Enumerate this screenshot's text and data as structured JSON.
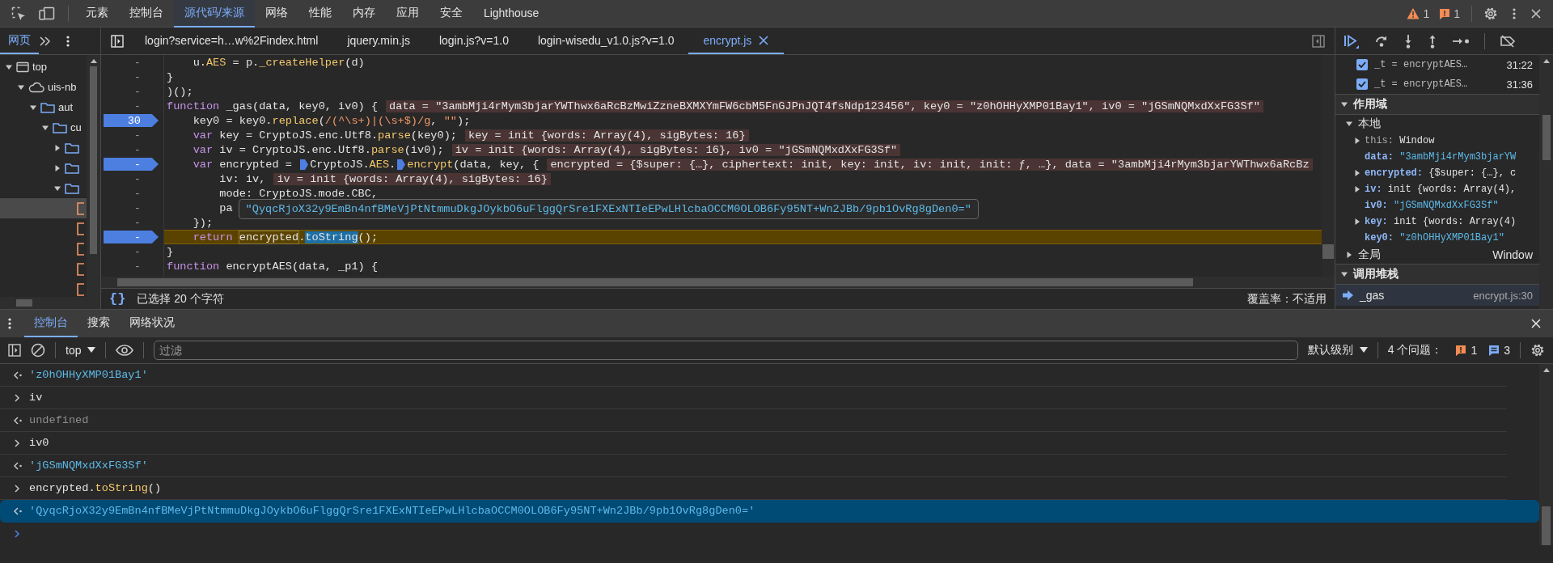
{
  "main_tabs": [
    {
      "label": "元素",
      "selected": false
    },
    {
      "label": "控制台",
      "selected": false
    },
    {
      "label": "源代码/来源",
      "selected": true
    },
    {
      "label": "网络",
      "selected": false
    },
    {
      "label": "性能",
      "selected": false
    },
    {
      "label": "内存",
      "selected": false
    },
    {
      "label": "应用",
      "selected": false
    },
    {
      "label": "安全",
      "selected": false
    },
    {
      "label": "Lighthouse",
      "selected": false
    }
  ],
  "issues": {
    "warnings": "1",
    "errors": "1"
  },
  "navigator": {
    "tabs": [
      {
        "label": "网页",
        "selected": true
      }
    ],
    "tree": [
      {
        "label": "top",
        "kind": "frame",
        "expanded": true,
        "selected": false,
        "children": [
          {
            "label": "uis-nb",
            "kind": "origin",
            "expanded": true,
            "selected": false,
            "children": [
              {
                "label": "aut",
                "kind": "folder",
                "expanded": true,
                "selected": false,
                "children": [
                  {
                    "label": "cu",
                    "kind": "folder",
                    "expanded": true,
                    "selected": false,
                    "children": [
                      {
                        "kind": "folder",
                        "expanded": false,
                        "selected": false
                      },
                      {
                        "kind": "folder",
                        "expanded": false,
                        "selected": false
                      },
                      {
                        "kind": "folder",
                        "expanded": true,
                        "selected": false,
                        "children": [
                          {
                            "kind": "file",
                            "selected": true
                          },
                          {
                            "kind": "file",
                            "selected": false
                          },
                          {
                            "kind": "file",
                            "selected": false
                          },
                          {
                            "kind": "file",
                            "selected": false
                          },
                          {
                            "kind": "file",
                            "selected": false
                          }
                        ]
                      }
                    ]
                  }
                ]
              }
            ]
          }
        ]
      }
    ]
  },
  "editor": {
    "tabs": [
      {
        "label": "login?service=h…w%2Findex.html",
        "selected": false
      },
      {
        "label": "jquery.min.js",
        "selected": false
      },
      {
        "label": "login.js?v=1.0",
        "selected": false
      },
      {
        "label": "login-wisedu_v1.0.js?v=1.0",
        "selected": false
      },
      {
        "label": "encrypt.js",
        "selected": true
      }
    ],
    "lines": [
      {
        "gutter": "-",
        "breakpoint": false,
        "current": false,
        "segments": [
          {
            "t": "    u.",
            "kind": "plain"
          },
          {
            "t": "AES",
            "kind": "prop"
          },
          {
            "t": " = p.",
            "kind": "plain"
          },
          {
            "t": "_createHelper",
            "kind": "prop"
          },
          {
            "t": "(d)",
            "kind": "plain"
          }
        ]
      },
      {
        "gutter": "-",
        "breakpoint": false,
        "current": false,
        "segments": [
          {
            "t": "}",
            "kind": "plain"
          }
        ]
      },
      {
        "gutter": "-",
        "breakpoint": false,
        "current": false,
        "segments": [
          {
            "t": ")();",
            "kind": "plain"
          }
        ]
      },
      {
        "gutter": "-",
        "breakpoint": false,
        "current": false,
        "segments": [
          {
            "t": "function",
            "kind": "kw"
          },
          {
            "t": " _gas(data, key0, iv0) {",
            "kind": "plain"
          }
        ],
        "hint": "data = \"3ambMji4rMym3bjarYWThwx6aRcBzMwiZzneBXMXYmFW6cbM5FnGJPnJQT4fsNdp123456\", key0 = \"z0hOHHyXMP01Bay1\", iv0 = \"jGSmNQMxdXxFG3Sf\""
      },
      {
        "gutter": "30",
        "breakpoint": true,
        "current": false,
        "segments": [
          {
            "t": "    key0 = key0.",
            "kind": "plain"
          },
          {
            "t": "replace",
            "kind": "prop"
          },
          {
            "t": "(",
            "kind": "plain"
          },
          {
            "t": "/(^\\s+)|(\\s+$)/g",
            "kind": "regex"
          },
          {
            "t": ", ",
            "kind": "plain"
          },
          {
            "t": "\"\"",
            "kind": "str"
          },
          {
            "t": ");",
            "kind": "plain"
          }
        ]
      },
      {
        "gutter": "-",
        "breakpoint": false,
        "current": false,
        "segments": [
          {
            "t": "    var",
            "kind": "kw"
          },
          {
            "t": " key = CryptoJS.enc.Utf8.",
            "kind": "plain"
          },
          {
            "t": "parse",
            "kind": "prop"
          },
          {
            "t": "(key0);",
            "kind": "plain"
          }
        ],
        "hint": "key = init {words: Array(4), sigBytes: 16}"
      },
      {
        "gutter": "-",
        "breakpoint": false,
        "current": false,
        "segments": [
          {
            "t": "    var",
            "kind": "kw"
          },
          {
            "t": " iv = CryptoJS.enc.Utf8.",
            "kind": "plain"
          },
          {
            "t": "parse",
            "kind": "prop"
          },
          {
            "t": "(iv0);",
            "kind": "plain"
          }
        ],
        "hint": "iv = init {words: Array(4), sigBytes: 16}, iv0 = \"jGSmNQMxdXxFG3Sf\""
      },
      {
        "gutter": "-",
        "breakpoint": true,
        "current": false,
        "segments": [
          {
            "t": "    var",
            "kind": "kw"
          },
          {
            "t": " encrypted = ",
            "kind": "plain"
          },
          {
            "kind": "marker"
          },
          {
            "t": "CryptoJS.",
            "kind": "plain"
          },
          {
            "t": "AES",
            "kind": "prop"
          },
          {
            "t": ".",
            "kind": "plain"
          },
          {
            "kind": "marker"
          },
          {
            "t": "encrypt",
            "kind": "prop"
          },
          {
            "t": "(data, key, {",
            "kind": "plain"
          }
        ],
        "hint": "encrypted = {$super: {…}, ciphertext: init, key: init, iv: init, init: ƒ, …}, data = \"3ambMji4rMym3bjarYWThwx6aRcBz"
      },
      {
        "gutter": "-",
        "breakpoint": false,
        "current": false,
        "segments": [
          {
            "t": "        iv: iv,",
            "kind": "plain"
          }
        ],
        "hint": "iv = init {words: Array(4), sigBytes: 16}"
      },
      {
        "gutter": "-",
        "breakpoint": false,
        "current": false,
        "segments": [
          {
            "t": "        mode: CryptoJS.mode.CBC,",
            "kind": "plain"
          }
        ]
      },
      {
        "gutter": "-",
        "breakpoint": false,
        "current": false,
        "segments": [
          {
            "t": "        pa",
            "kind": "plain"
          }
        ]
      },
      {
        "gutter": "-",
        "breakpoint": false,
        "current": false,
        "segments": [
          {
            "t": "    });",
            "kind": "plain"
          }
        ]
      },
      {
        "gutter": "-",
        "breakpoint": true,
        "current": true,
        "segments": [
          {
            "t": "    return ",
            "kind": "kw"
          },
          {
            "t": "encrypted",
            "kind": "hover"
          },
          {
            "t": ".",
            "kind": "plain"
          },
          {
            "t": "toString",
            "kind": "selection"
          },
          {
            "t": "();",
            "kind": "plain"
          }
        ]
      },
      {
        "gutter": "-",
        "breakpoint": false,
        "current": false,
        "segments": [
          {
            "t": "}",
            "kind": "plain"
          }
        ]
      },
      {
        "gutter": "-",
        "breakpoint": false,
        "current": false,
        "segments": [
          {
            "t": "function",
            "kind": "kw"
          },
          {
            "t": " encryptAES(data, _p1) {",
            "kind": "plain"
          }
        ]
      }
    ],
    "tooltip": "\"QyqcRjoX32y9EmBn4nfBMeVjPtNtmmuDkgJOykbO6uFlggQrSre1FXExNTIeEPwLHlcbaOCCM0OLOB6Fy95NT+Wn2JBb/9pb1OvRg8gDen0=\"",
    "status": {
      "pretty_print": "{}",
      "selection": "已选择 20 个字符",
      "coverage": "覆盖率：不适用"
    }
  },
  "debugger": {
    "breakpoints": [
      {
        "code": "_t = encryptAES…",
        "location": "31:22",
        "checked": true
      },
      {
        "code": "_t = encryptAES…",
        "location": "31:36",
        "checked": true
      }
    ],
    "scope": {
      "title": "作用域",
      "expanded": true,
      "groups": [
        {
          "title": "本地",
          "expanded": true,
          "entries": [
            {
              "name": "this:",
              "kind": "object",
              "own": false,
              "value": "Window"
            },
            {
              "name": "data:",
              "kind": "string",
              "own": true,
              "value": "\"3ambMji4rMym3bjarYW"
            },
            {
              "name": "encrypted:",
              "kind": "object",
              "own": true,
              "value": "{$super: {…}, c"
            },
            {
              "name": "iv:",
              "kind": "object",
              "own": true,
              "value": "init {words: Array(4),"
            },
            {
              "name": "iv0:",
              "kind": "string",
              "own": true,
              "value": "\"jGSmNQMxdXxFG3Sf\""
            },
            {
              "name": "key:",
              "kind": "object",
              "own": true,
              "value": "init {words: Array(4)"
            },
            {
              "name": "key0:",
              "kind": "string",
              "own": true,
              "value": "\"z0hOHHyXMP01Bay1\""
            }
          ]
        },
        {
          "title": "全局",
          "expanded": false,
          "value": "Window"
        }
      ]
    },
    "call_stack": {
      "title": "调用堆栈",
      "expanded": true,
      "frames": [
        {
          "name": "_gas",
          "location": "encrypt.js:30",
          "selected": true
        }
      ]
    }
  },
  "drawer": {
    "tabs": [
      {
        "label": "控制台",
        "selected": true
      },
      {
        "label": "搜索",
        "selected": false
      },
      {
        "label": "网络状况",
        "selected": false
      }
    ],
    "context": "top",
    "filter": {
      "placeholder": "过滤"
    },
    "level": "默认级别",
    "issues": {
      "label": "4 个问题：",
      "errors": "1",
      "info": "3"
    },
    "entries": [
      {
        "kind": "result",
        "selected": false,
        "segments": [
          {
            "t": "'z0hOHHyXMP01Bay1'",
            "kind": "str"
          }
        ]
      },
      {
        "kind": "input",
        "selected": false,
        "segments": [
          {
            "t": "iv",
            "kind": "plain"
          }
        ]
      },
      {
        "kind": "result",
        "selected": false,
        "segments": [
          {
            "t": "undefined",
            "kind": "undef"
          }
        ]
      },
      {
        "kind": "input",
        "selected": false,
        "segments": [
          {
            "t": "iv0",
            "kind": "plain"
          }
        ]
      },
      {
        "kind": "result",
        "selected": false,
        "segments": [
          {
            "t": "'jGSmNQMxdXxFG3Sf'",
            "kind": "str"
          }
        ]
      },
      {
        "kind": "input",
        "selected": false,
        "segments": [
          {
            "t": "encrypted.",
            "kind": "plain"
          },
          {
            "t": "toString",
            "kind": "method"
          },
          {
            "t": "()",
            "kind": "plain"
          }
        ]
      },
      {
        "kind": "result",
        "selected": true,
        "segments": [
          {
            "t": "'QyqcRjoX32y9EmBn4nfBMeVjPtNtmmuDkgJOykbO6uFlggQrSre1FXExNTIeEPwLHlcbaOCCM0OLOB6Fy95NT+Wn2JBb/9pb1OvRg8gDen0='",
            "kind": "str"
          }
        ]
      }
    ]
  }
}
